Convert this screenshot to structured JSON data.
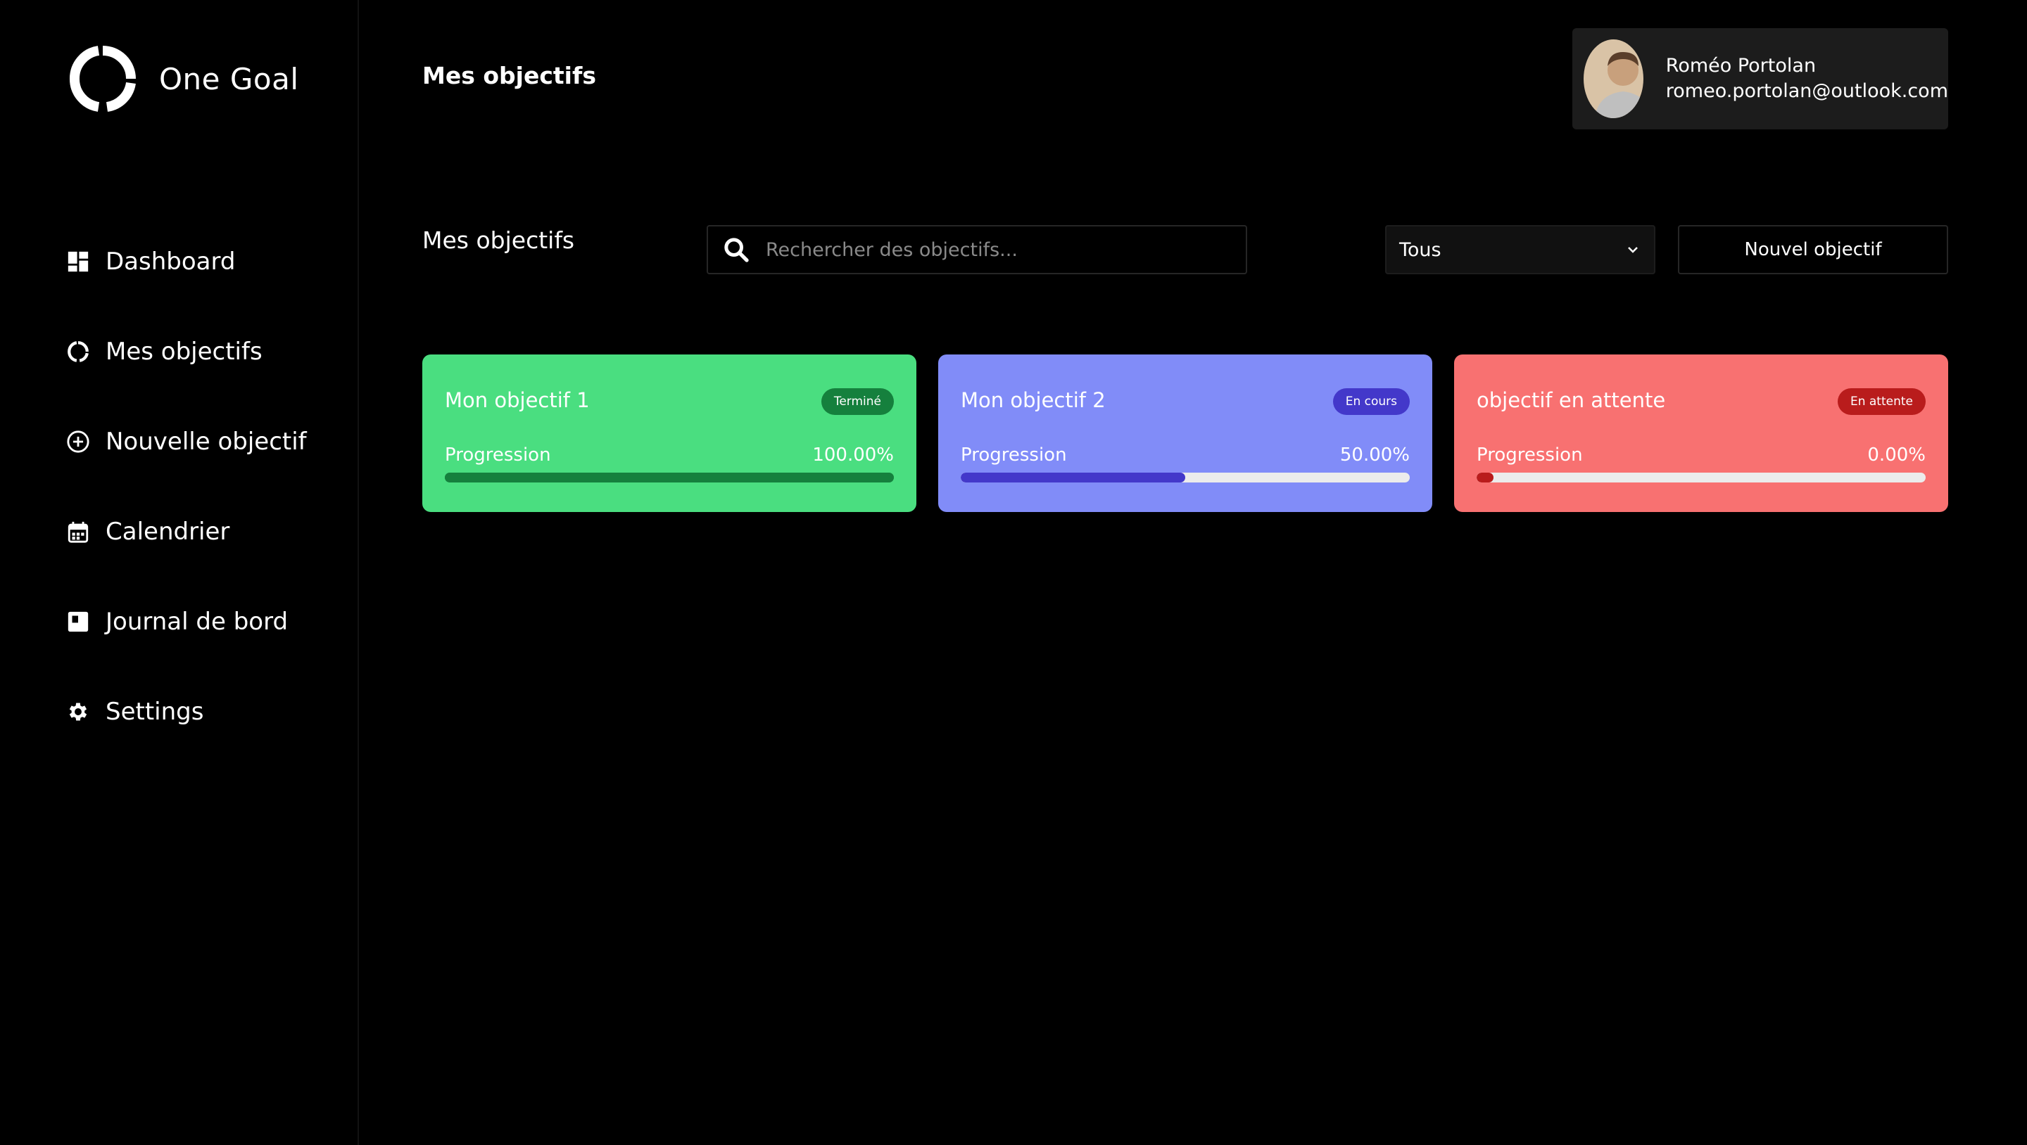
{
  "app": {
    "name": "One Goal"
  },
  "sidebar": {
    "items": [
      {
        "label": "Dashboard",
        "icon": "dashboard-icon"
      },
      {
        "label": "Mes objectifs",
        "icon": "goals-icon"
      },
      {
        "label": "Nouvelle objectif",
        "icon": "plus-circle-icon"
      },
      {
        "label": "Calendrier",
        "icon": "calendar-icon"
      },
      {
        "label": "Journal de bord",
        "icon": "journal-icon"
      },
      {
        "label": "Settings",
        "icon": "gear-icon"
      }
    ]
  },
  "header": {
    "title": "Mes objectifs"
  },
  "user": {
    "name": "Roméo Portolan",
    "email": "romeo.portolan@outlook.com"
  },
  "toolbar": {
    "section_title": "Mes objectifs",
    "search_placeholder": "Rechercher des objectifs...",
    "filter_value": "Tous",
    "new_button": "Nouvel objectif"
  },
  "goals": [
    {
      "title": "Mon objectif 1",
      "status": "Terminé",
      "progress_label": "Progression",
      "progress_text": "100.00%",
      "progress": 1.0,
      "bg": "#4ade80",
      "badge_bg": "#15803d",
      "fill": "#15803d",
      "track": "#15803d"
    },
    {
      "title": "Mon objectif 2",
      "status": "En cours",
      "progress_label": "Progression",
      "progress_text": "50.00%",
      "progress": 0.5,
      "bg": "#818cf8",
      "badge_bg": "#4338ca",
      "fill": "#4338ca",
      "track": "#ececec"
    },
    {
      "title": "objectif en attente",
      "status": "En attente",
      "progress_label": "Progression",
      "progress_text": "0.00%",
      "progress": 0.0,
      "bg": "#f87171",
      "badge_bg": "#b91c1c",
      "fill": "#b91c1c",
      "track": "#ececec"
    }
  ]
}
